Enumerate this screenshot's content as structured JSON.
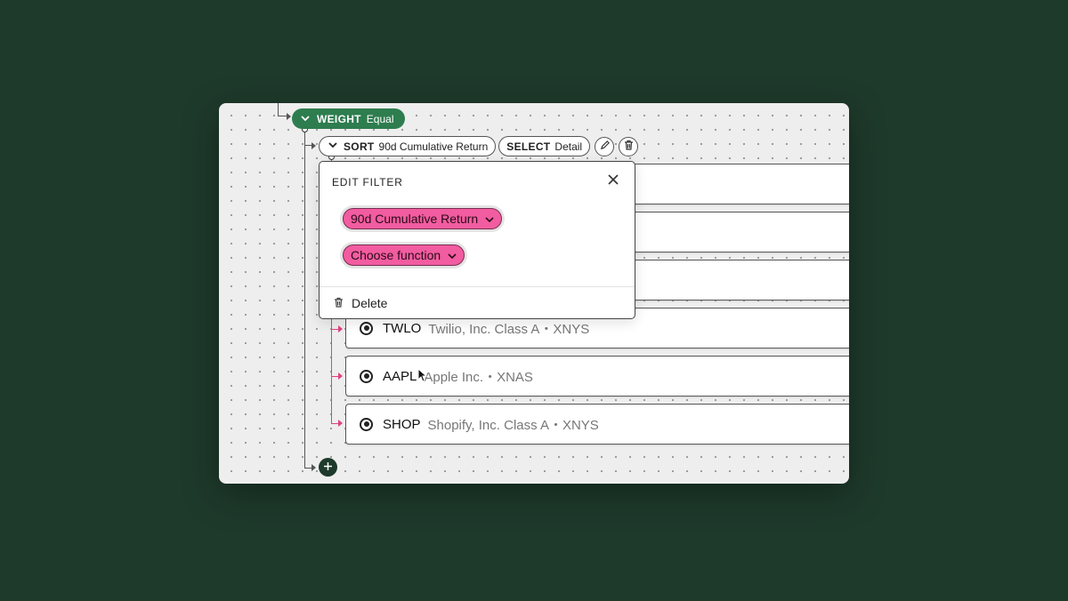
{
  "weight_node": {
    "keyword": "WEIGHT",
    "value": "Equal"
  },
  "sort_node": {
    "keyword": "SORT",
    "value": "90d Cumulative Return"
  },
  "select_node": {
    "keyword": "SELECT",
    "value": "Detail"
  },
  "edit_filter": {
    "title": "EDIT FILTER",
    "metric_chip": "90d Cumulative Return",
    "function_chip": "Choose function",
    "delete_label": "Delete"
  },
  "assets": [
    {
      "ticker": "TWLO",
      "description": "Twilio, Inc. Class A・XNYS"
    },
    {
      "ticker": "AAPL",
      "description": "Apple Inc.・XNAS"
    },
    {
      "ticker": "SHOP",
      "description": "Shopify, Inc. Class A・XNYS"
    }
  ],
  "colors": {
    "background": "#1e3a2b",
    "weight_pill": "#2e7d4f",
    "filter_chip": "#f25ca0",
    "connector_pink": "#e0427f"
  }
}
